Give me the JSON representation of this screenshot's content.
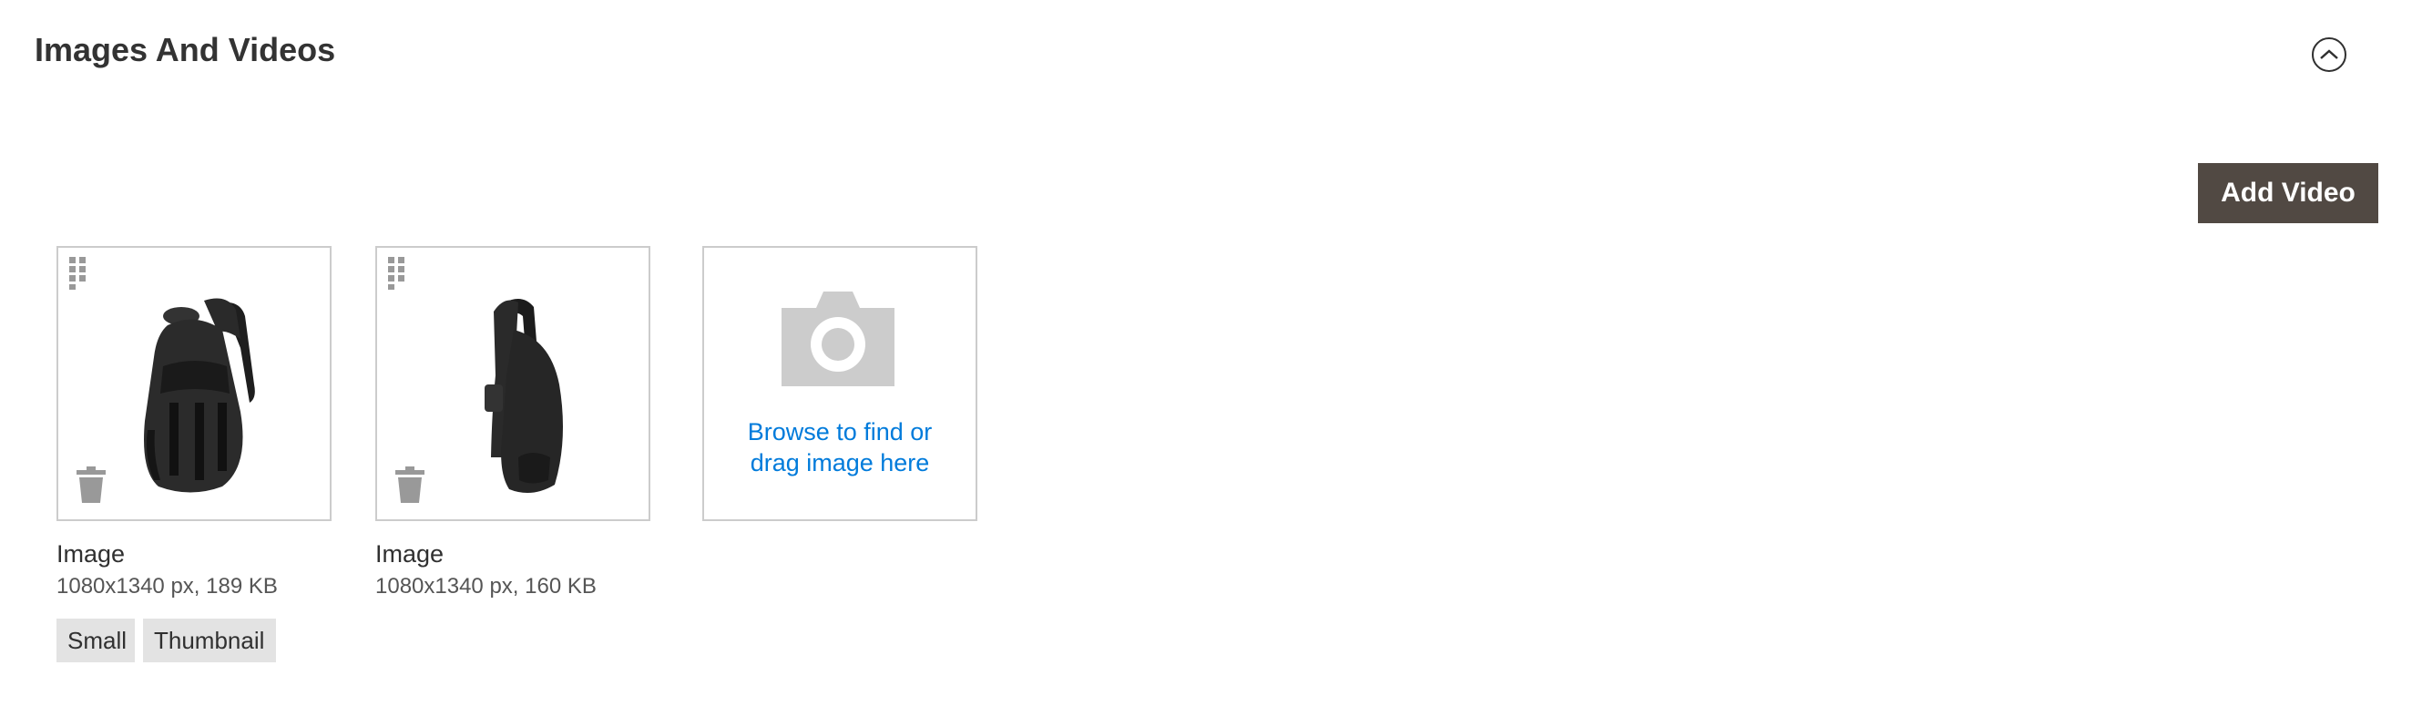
{
  "section": {
    "title": "Images And Videos"
  },
  "toolbar": {
    "add_video_label": "Add Video"
  },
  "images": [
    {
      "label": "Image",
      "meta": "1080x1340 px, 189 KB",
      "roles": [
        "Small",
        "Thumbnail"
      ]
    },
    {
      "label": "Image",
      "meta": "1080x1340 px, 160 KB",
      "roles": []
    }
  ],
  "uploader": {
    "line1": "Browse to find or",
    "line2": "drag image here"
  },
  "colors": {
    "button_bg": "#514943",
    "link": "#007bdb",
    "card_border": "#cccccc",
    "badge_bg": "#e3e3e3",
    "icon_gray": "#999999"
  }
}
